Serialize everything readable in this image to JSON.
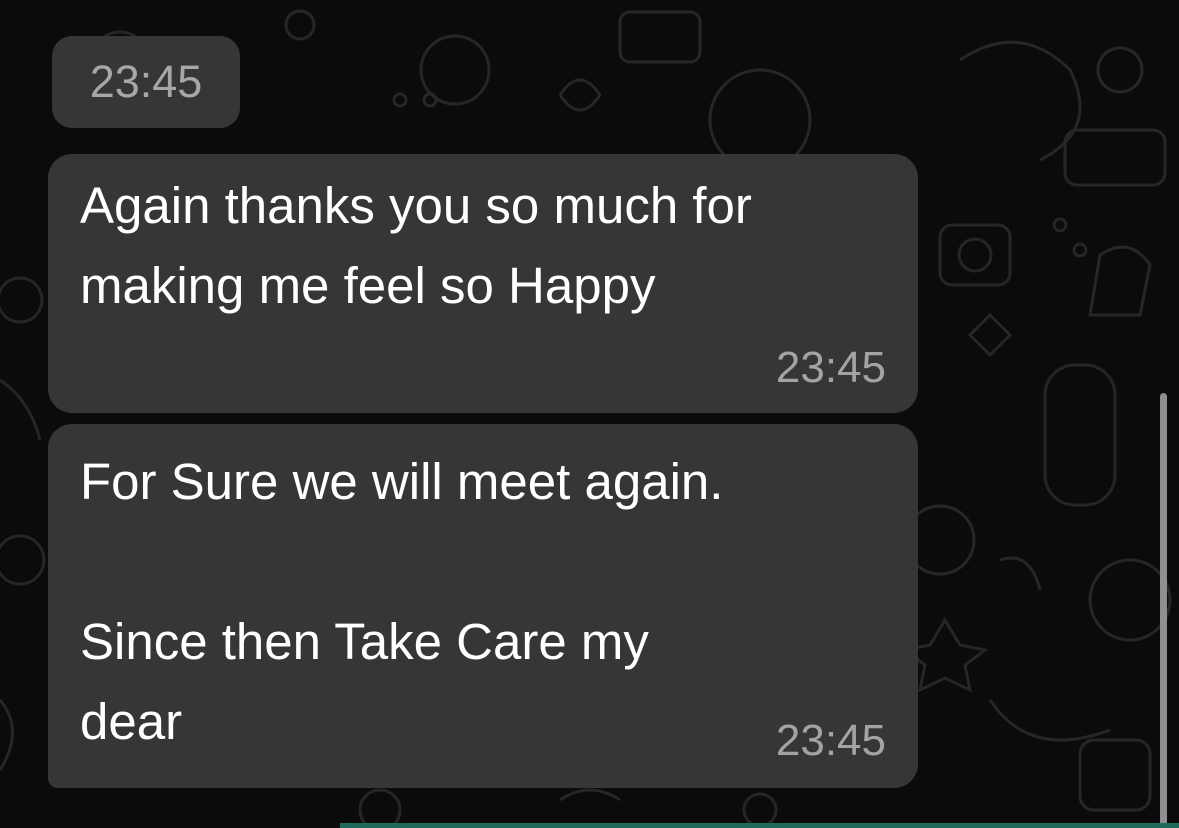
{
  "chat": {
    "date_chip": "23:45",
    "messages": [
      {
        "text": "Again thanks you so much for\nmaking me feel so Happy",
        "time": "23:45"
      },
      {
        "text": "For Sure we will meet again.\n\nSince then Take Care my\ndear",
        "time": "23:45"
      }
    ]
  },
  "colors": {
    "background": "#0b0b0b",
    "bubble": "#363638",
    "text": "#ffffff",
    "time": "#a3a3a6"
  }
}
